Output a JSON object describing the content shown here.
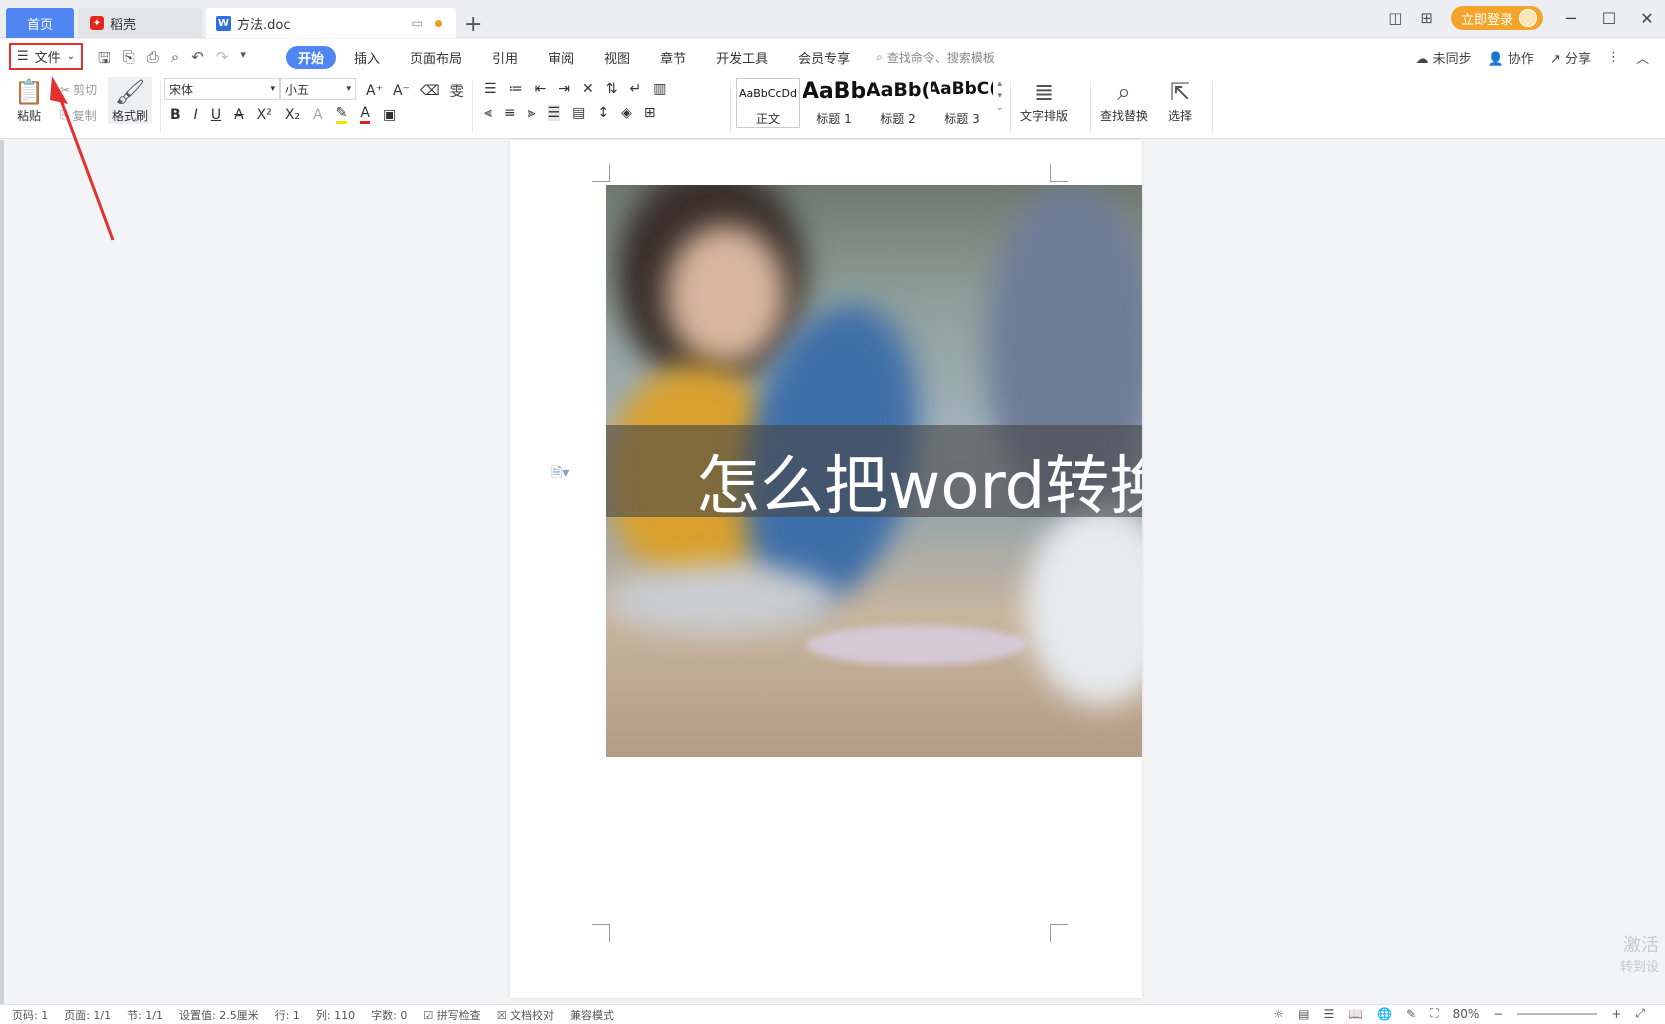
{
  "titlebar": {
    "tabs": [
      {
        "label": "首页"
      },
      {
        "label": "稻壳"
      },
      {
        "label": "方法.doc"
      }
    ],
    "login_label": "立即登录"
  },
  "menubar": {
    "file_label": "文件",
    "items": [
      "开始",
      "插入",
      "页面布局",
      "引用",
      "审阅",
      "视图",
      "章节",
      "开发工具",
      "会员专享"
    ],
    "search_placeholder": "查找命令、搜索模板",
    "right": [
      "未同步",
      "协作",
      "分享"
    ]
  },
  "ribbon": {
    "paste": "粘贴",
    "cut": "剪切",
    "copy": "复制",
    "format_painter": "格式刷",
    "font_name": "宋体",
    "font_size": "小五",
    "styles": [
      {
        "sample": "AaBbCcDd",
        "label": "正文"
      },
      {
        "sample": "AaBb",
        "label": "标题 1"
      },
      {
        "sample": "AaBb(",
        "label": "标题 2"
      },
      {
        "sample": "AaBbC(",
        "label": "标题 3"
      }
    ],
    "text_layout": "文字排版",
    "find_replace": "查找替换",
    "select": "选择"
  },
  "document": {
    "hero_title": "怎么把word转换"
  },
  "watermark": {
    "line1": "激活",
    "line2": "转到设"
  },
  "statusbar": {
    "items": [
      "页码: 1",
      "页面: 1/1",
      "节: 1/1",
      "设置值: 2.5厘米",
      "行: 1",
      "列: 110",
      "字数: 0",
      "拼写检查",
      "文档校对",
      "兼容模式"
    ],
    "zoom": "80%"
  },
  "colors": {
    "accent": "#4f86f2",
    "login": "#f3a52b",
    "annotation": "#e53030"
  }
}
